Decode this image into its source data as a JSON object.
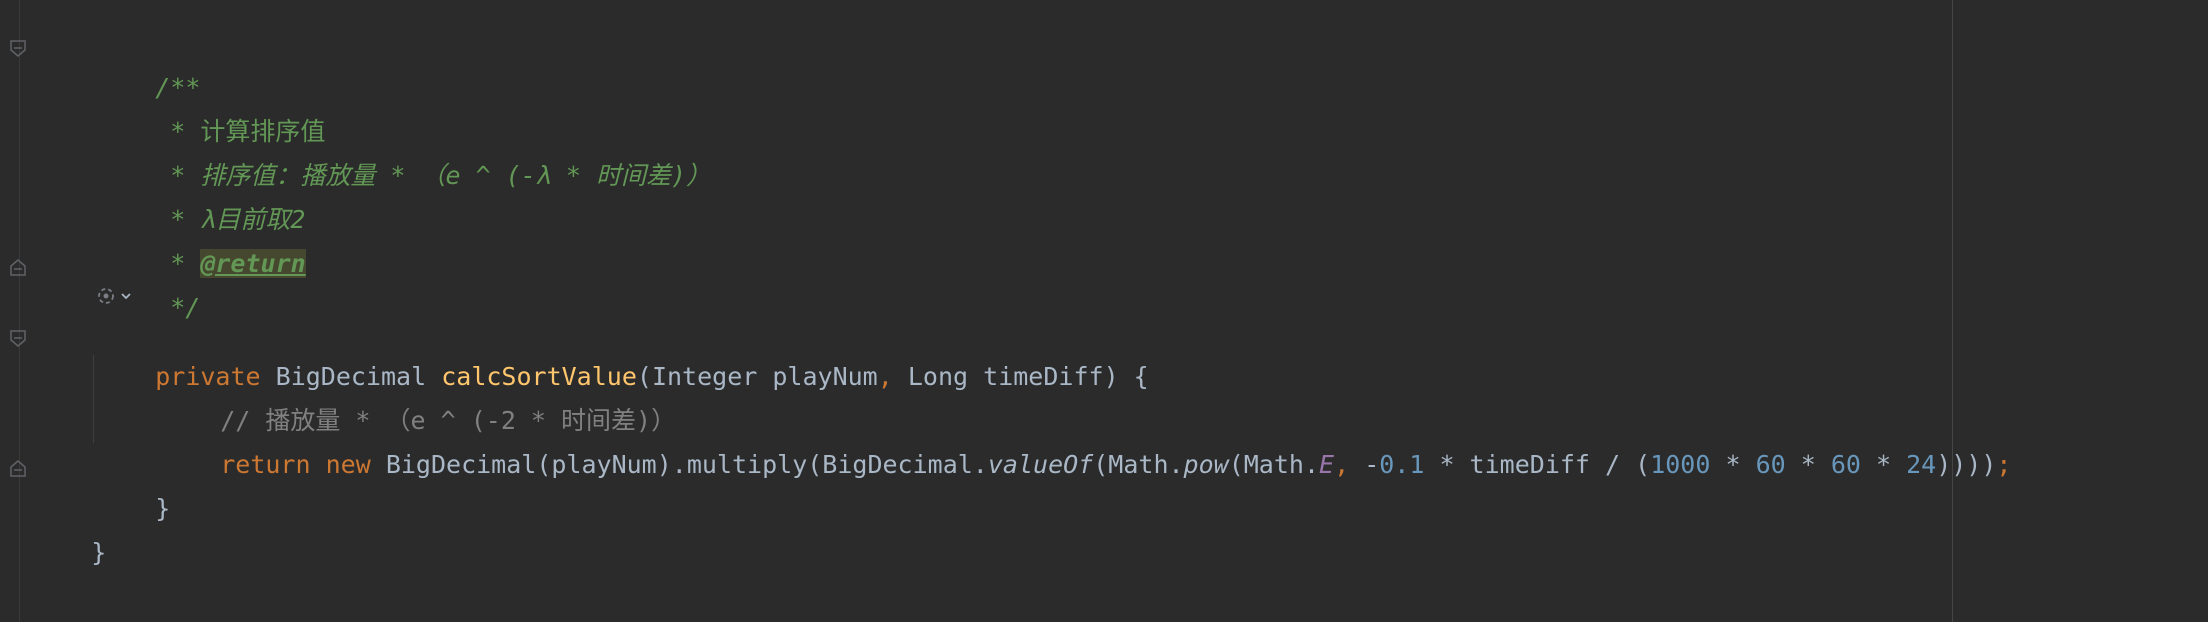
{
  "editor": {
    "lines": {
      "l1": {
        "text": "/**"
      },
      "l2": {
        "star": "* ",
        "text": "计算排序值"
      },
      "l3": {
        "star": "* ",
        "text": "排序值：播放量 * （e ^ (-λ * 时间差)）"
      },
      "l4": {
        "star": "* ",
        "text": "λ目前取2"
      },
      "l5": {
        "star": "* ",
        "tag": "@return"
      },
      "l6": {
        "text": "*/"
      },
      "l7": {
        "kw_private": "private",
        "type_ret": "BigDecimal",
        "method": "calcSortValue",
        "p_open": "(",
        "type_p1": "Integer",
        "p1": "playNum",
        "comma": ",",
        "type_p2": "Long",
        "p2": "timeDiff",
        "p_close": ") {"
      },
      "l8": {
        "text": "// 播放量 * （e ^ (-2 * 时间差)）"
      },
      "l9": {
        "kw_return": "return",
        "kw_new": "new",
        "t1": "BigDecimal(playNum).multiply(BigDecimal.",
        "value_of": "valueOf",
        "t2": "(Math.",
        "pow": "pow",
        "t3": "(Math.",
        "const_e": "E",
        "comma": ",",
        "t4": " -",
        "n1": "0.1",
        "t5": " * timeDiff / (",
        "n2": "1000",
        "t6": " * ",
        "n3": "60",
        "t7": " * ",
        "n4": "60",
        "t8": " * ",
        "n5": "24",
        "t9": "))))",
        "semi": ";"
      },
      "l10": {
        "text": "}"
      },
      "l11": {
        "text": "}"
      }
    },
    "icons": {
      "fold": "fold-icon",
      "inlay": "ai-assistant-icon"
    }
  }
}
